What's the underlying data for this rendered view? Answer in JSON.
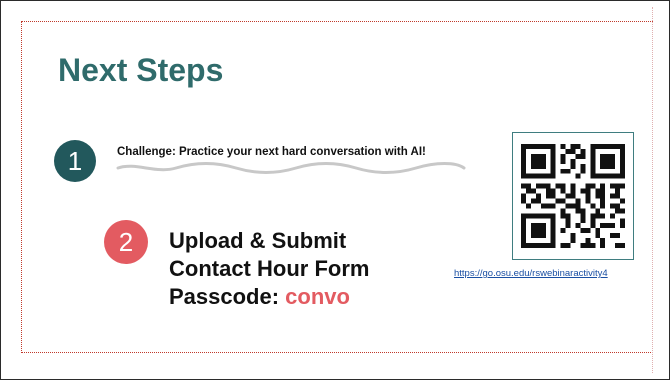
{
  "slide": {
    "title": "Next Steps",
    "steps": [
      {
        "number": "1",
        "text": "Challenge: Practice your next hard conversation with AI!"
      },
      {
        "number": "2",
        "line1": "Upload & Submit",
        "line2": "Contact Hour Form",
        "passcode_label": "Passcode: ",
        "passcode_value": "convo"
      }
    ],
    "qr": {
      "icon": "qr-code-icon",
      "link": "https://go.osu.edu/rswebinaractivity4"
    }
  },
  "colors": {
    "title": "#2f6b6b",
    "step1": "#22585c",
    "step2": "#e35b61",
    "link": "#1a4fa3",
    "border": "#c0392b"
  }
}
